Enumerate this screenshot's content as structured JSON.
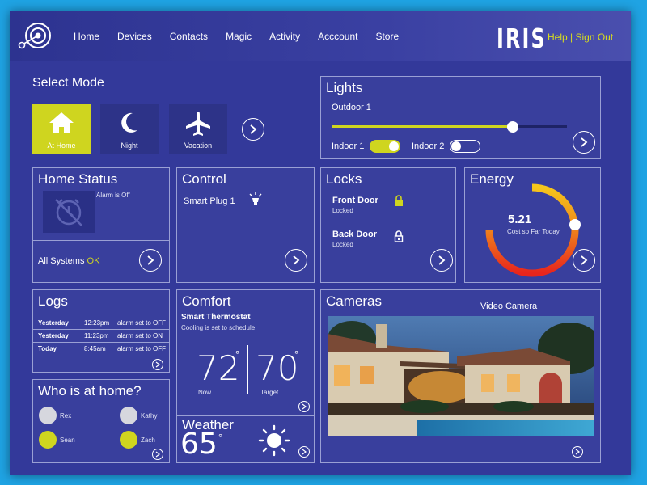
{
  "header": {
    "nav": [
      "Home",
      "Devices",
      "Contacts",
      "Magic",
      "Activity",
      "Acccount",
      "Store"
    ],
    "brand": "IRIS",
    "help": "Help",
    "separator": " | ",
    "sign_out": "Sign Out"
  },
  "select_mode": {
    "title": "Select Mode",
    "modes": [
      {
        "label": "At Home",
        "icon": "house-icon",
        "active": true
      },
      {
        "label": "Night",
        "icon": "moon-icon",
        "active": false
      },
      {
        "label": "Vacation",
        "icon": "airplane-icon",
        "active": false
      }
    ]
  },
  "lights": {
    "title": "Lights",
    "outdoor_label": "Outdoor 1",
    "outdoor_level": 0.77,
    "indoor1_label": "Indoor 1",
    "indoor1_on": true,
    "indoor2_label": "Indoor 2",
    "indoor2_on": false
  },
  "home_status": {
    "title": "Home Status",
    "alarm_text": "Alarm is Off",
    "systems_text": "All Systems",
    "systems_status": "OK"
  },
  "control": {
    "title": "Control",
    "device": "Smart Plug 1"
  },
  "locks": {
    "title": "Locks",
    "items": [
      {
        "name": "Front Door",
        "state": "Locked",
        "icon": "lock-closed-icon"
      },
      {
        "name": "Back Door",
        "state": "Locked",
        "icon": "lock-icon"
      }
    ]
  },
  "energy": {
    "title": "Energy",
    "value": "5.21",
    "caption": "Cost so Far Today"
  },
  "logs": {
    "title": "Logs",
    "rows": [
      {
        "day": "Yesterday",
        "time": "12:23pm",
        "event": "alarm set to OFF"
      },
      {
        "day": "Yesterday",
        "time": "11:23pm",
        "event": "alarm set to ON"
      },
      {
        "day": "Today",
        "time": "8:45am",
        "event": "alarm set to OFF"
      }
    ]
  },
  "who_home": {
    "title": "Who is at home?",
    "people": [
      {
        "name": "Rex",
        "home": false
      },
      {
        "name": "Kathy",
        "home": false
      },
      {
        "name": "Sean",
        "home": true
      },
      {
        "name": "Zach",
        "home": true
      }
    ]
  },
  "comfort": {
    "title": "Comfort",
    "device": "Smart Thermostat",
    "status": "Cooling is set to schedule",
    "now_temp": "72",
    "now_label": "Now",
    "target_temp": "70",
    "target_label": "Target",
    "degree": "°"
  },
  "weather": {
    "title": "Weather",
    "temp": "65",
    "degree": "°",
    "icon": "sun-icon"
  },
  "cameras": {
    "title": "Cameras",
    "camera_label": "Video Camera"
  },
  "colors": {
    "background": "#33399a",
    "accent": "#cfd51f",
    "frame": "#1fa3e3"
  }
}
